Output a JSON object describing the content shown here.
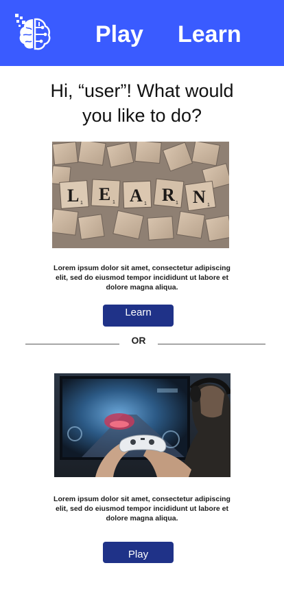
{
  "header": {
    "background_color": "#3a5bff",
    "logo_icon": "brain-circuit-icon",
    "nav": {
      "play_label": "Play",
      "learn_label": "Learn"
    }
  },
  "main": {
    "title_line1": "Hi, “user”! What would",
    "title_line2": "you like to do?",
    "learn_section": {
      "image_icon": "scrabble-tiles-learn-image",
      "description": "Lorem ipsum dolor sit amet, consectetur adipiscing elit, sed do eiusmod tempor incididunt ut labore et dolore magna aliqua.",
      "button_label": "Learn"
    },
    "divider_label": "OR",
    "play_section": {
      "image_icon": "gamer-controller-image",
      "description": "Lorem ipsum dolor sit amet, consectetur adipiscing elit, sed do eiusmod tempor incididunt ut labore et dolore magna aliqua.",
      "button_label": "Play"
    }
  },
  "colors": {
    "header_blue": "#3a5bff",
    "button_navy": "#1f3288",
    "text_dark": "#111111"
  }
}
